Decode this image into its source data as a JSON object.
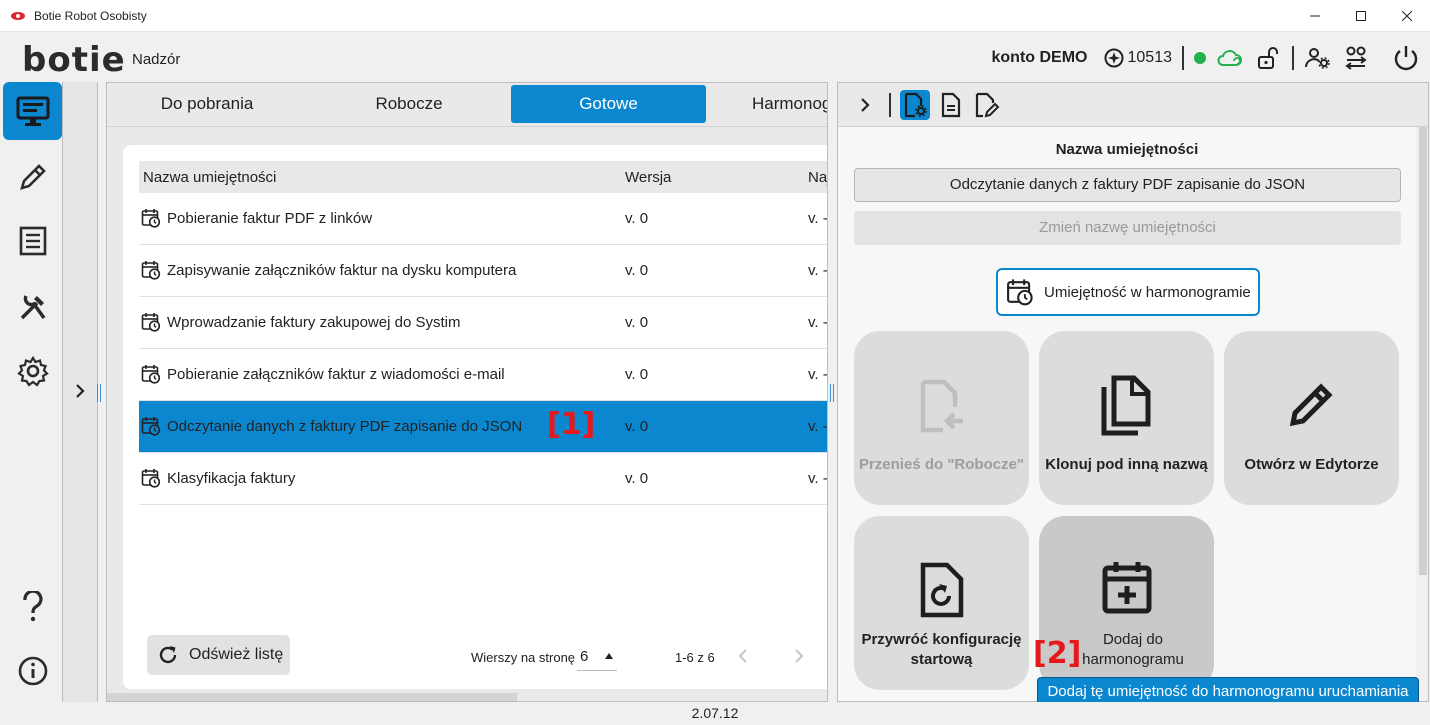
{
  "window": {
    "title": "Botie Robot Osobisty",
    "controls": [
      "minimize-icon",
      "maximize-icon",
      "close-icon"
    ]
  },
  "header": {
    "logo": "botie",
    "section": "Nadzór",
    "account": "konto DEMO",
    "credits": "10513",
    "status_color": "#22b14c"
  },
  "nav": {
    "items": [
      "monitor-icon",
      "pencil-icon",
      "list-icon",
      "tools-icon",
      "gear-icon",
      "help-icon",
      "info-icon"
    ]
  },
  "tabs": [
    {
      "label": "Do pobrania"
    },
    {
      "label": "Robocze"
    },
    {
      "label": "Gotowe",
      "active": true
    },
    {
      "label": "Harmonogram"
    }
  ],
  "table": {
    "columns": [
      "Nazwa umiejętności",
      "Wersja",
      "Naj"
    ],
    "rows": [
      {
        "name": "Pobieranie faktur PDF z linków",
        "version": "v. 0",
        "last": "v. -"
      },
      {
        "name": "Zapisywanie załączników faktur na dysku komputera",
        "version": "v. 0",
        "last": "v. -"
      },
      {
        "name": "Wprowadzanie faktury zakupowej do Systim",
        "version": "v. 0",
        "last": "v. -"
      },
      {
        "name": "Pobieranie załączników faktur z wiadomości e-mail",
        "version": "v. 0",
        "last": "v. -"
      },
      {
        "name": "Odczytanie danych z faktury PDF zapisanie do JSON",
        "version": "v. 0",
        "last": "v. -",
        "selected": true
      },
      {
        "name": "Klasyfikacja faktury",
        "version": "v. 0",
        "last": "v. -"
      }
    ],
    "marker": "[1]"
  },
  "footer": {
    "refresh": "Odśwież listę",
    "rows_per_page_label": "Wierszy na stronę",
    "rows_per_page": "6",
    "range": "1-6 z 6"
  },
  "panel": {
    "name_label": "Nazwa umiejętności",
    "name_value": "Odczytanie danych z faktury PDF zapisanie do JSON",
    "rename": "Zmień nazwę umiejętności",
    "schedule_badge": "Umiejętność w harmonogramie",
    "tiles": {
      "move": "Przenieś do \"Robocze\"",
      "clone": "Klonuj pod inną nazwą",
      "edit": "Otwórz w Edytorze",
      "restore": "Przywróć konfigurację startową",
      "add_schedule": "Dodaj do harmonogramu"
    },
    "marker": "[2]",
    "tooltip": "Dodaj tę umiejętność do harmonogramu uruchamiania"
  },
  "version": "2.07.12",
  "colors": {
    "accent": "#0b87d0",
    "marker": "#e5191b"
  }
}
